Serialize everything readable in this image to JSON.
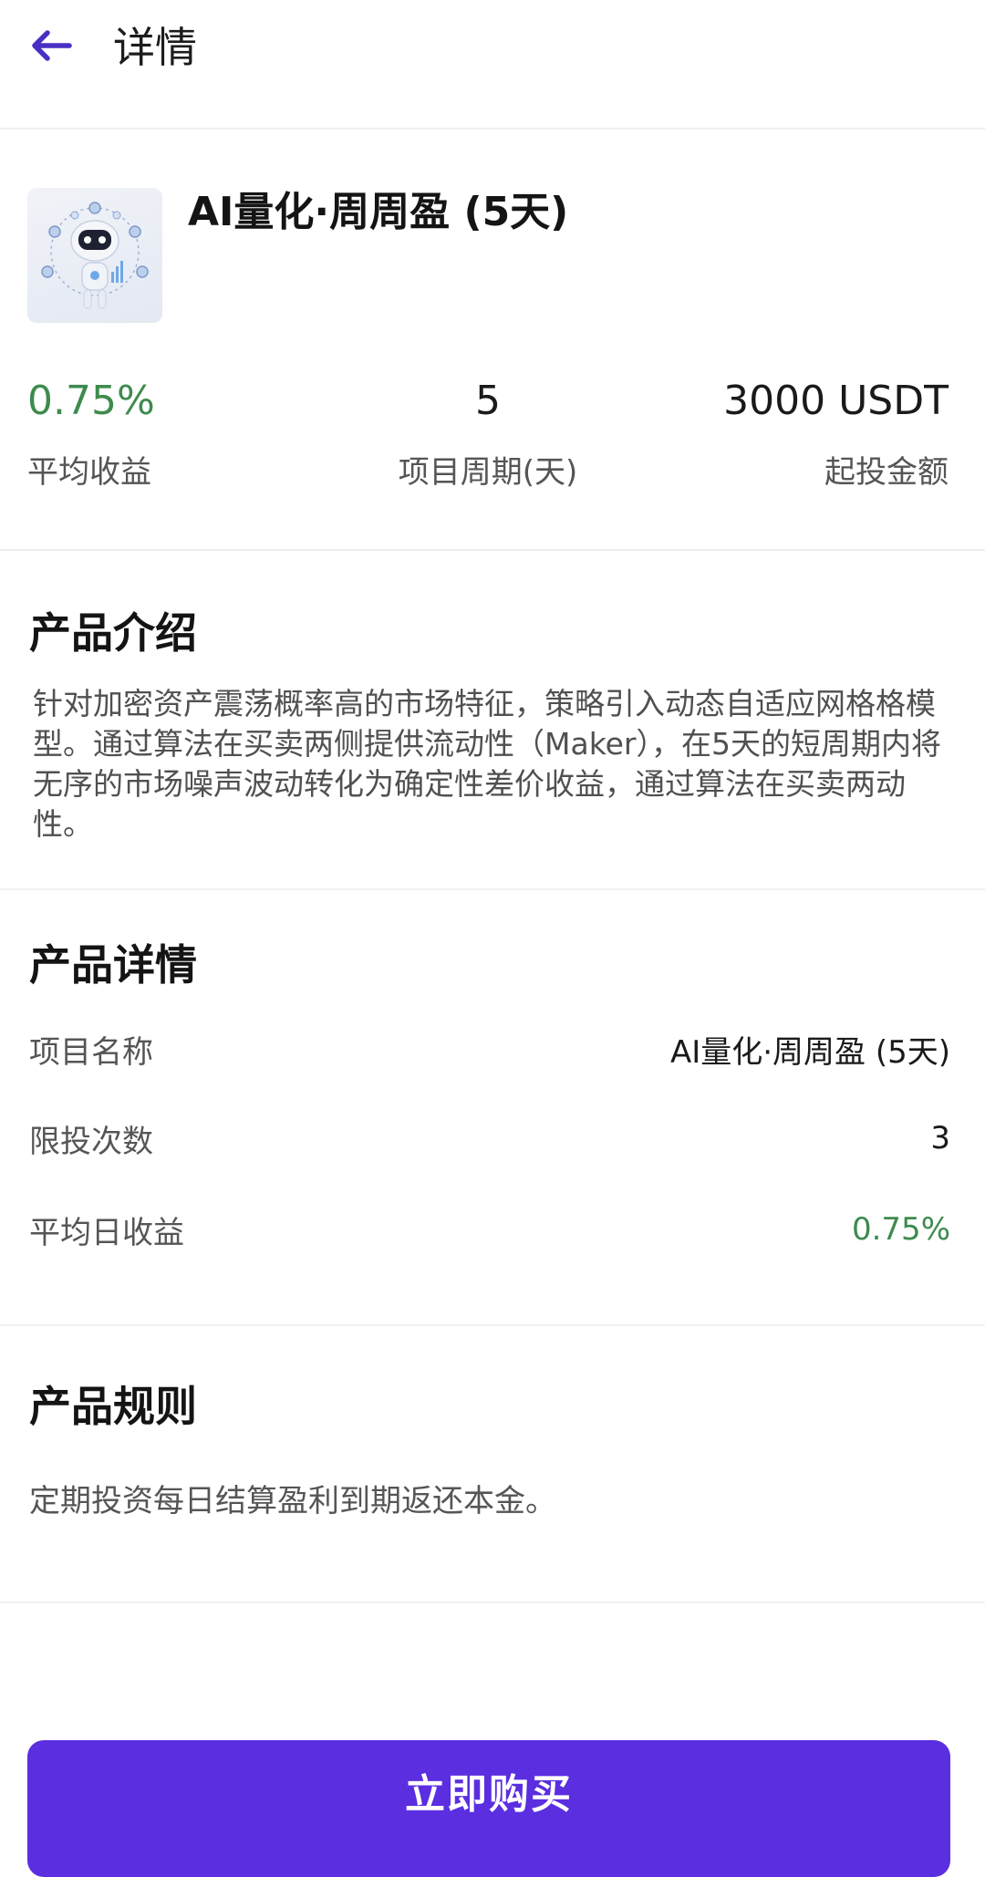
{
  "header": {
    "title": "详情",
    "back_icon": "arrow-left-icon"
  },
  "product": {
    "name": "AI量化·周周盈 (5天)",
    "image_icon": "robot-icon",
    "stats": [
      {
        "value": "0.75%",
        "label": "平均收益"
      },
      {
        "value": "5",
        "label": "项目周期(天)"
      },
      {
        "value": "3000 USDT",
        "label": "起投金额"
      }
    ]
  },
  "intro": {
    "title": "产品介绍",
    "text": "针对加密资产震荡概率高的市场特征，策略引入动态自适应网格格模型。通过算法在买卖两侧提供流动性（Maker），在5天的短周期内将无序的市场噪声波动转化为确定性差价收益，通过算法在买卖两动性。"
  },
  "details": {
    "title": "产品详情",
    "rows": [
      {
        "label": "项目名称",
        "value": "AI量化·周周盈 (5天)"
      },
      {
        "label": "限投次数",
        "value": "3"
      },
      {
        "label": "平均日收益",
        "value": "0.75%"
      }
    ]
  },
  "rules": {
    "title": "产品规则",
    "text": "定期投资每日结算盈利到期返还本金。"
  },
  "buy_button": {
    "label": "立即购买"
  },
  "colors": {
    "accent": "#5b2ee0",
    "positive": "#3e8b4e"
  }
}
